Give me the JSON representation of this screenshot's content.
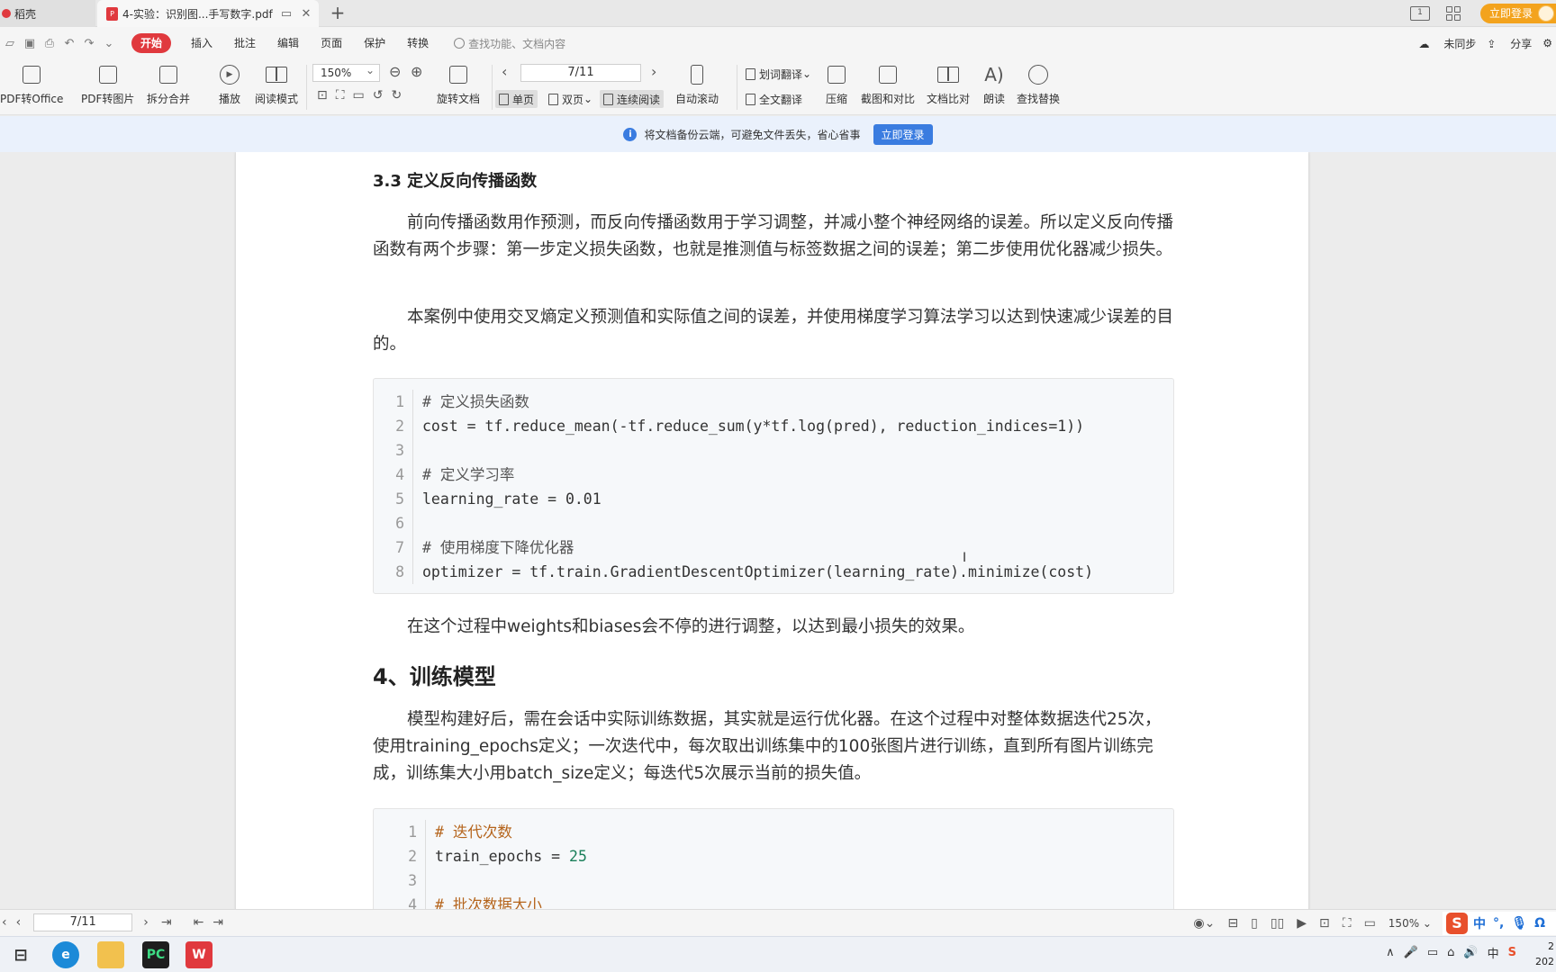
{
  "tabs": {
    "home_label": "稻壳",
    "doc_label": "4-实验：识别图...手写数字.pdf",
    "login_label": "立即登录"
  },
  "menubar": {
    "items": [
      "开始",
      "插入",
      "批注",
      "编辑",
      "页面",
      "保护",
      "转换"
    ],
    "search_placeholder": "查找功能、文档内容",
    "sync_label": "未同步",
    "share_label": "分享"
  },
  "ribbon": {
    "pdf_to_office": "PDF转Office",
    "pdf_to_image": "PDF转图片",
    "split_merge": "拆分合并",
    "play": "播放",
    "read_mode": "阅读模式",
    "zoom": "150%",
    "rotate_doc": "旋转文档",
    "page_indicator": "7/11",
    "single_page": "单页",
    "double_page": "双页",
    "continuous_read": "连续阅读",
    "auto_scroll": "自动滚动",
    "word_translate": "划词翻译",
    "full_translate": "全文翻译",
    "compress": "压缩",
    "screenshot_compare": "截图和对比",
    "doc_compare": "文档比对",
    "read_aloud": "朗读",
    "find_replace": "查找替换"
  },
  "notice": {
    "text": "将文档备份云端，可避免文件丢失，省心省事",
    "button": "立即登录"
  },
  "document": {
    "section_3_3": "3.3 定义反向传播函数",
    "para1": "前向传播函数用作预测，而反向传播函数用于学习调整，并减小整个神经网络的误差。所以定义反向传播函数有两个步骤：第一步定义损失函数，也就是推测值与标签数据之间的误差；第二步使用优化器减少损失。",
    "para2": "本案例中使用交叉熵定义预测值和实际值之间的误差，并使用梯度学习算法学习以达到快速减少误差的目的。",
    "code1": [
      {
        "n": "1",
        "text": "# 定义损失函数"
      },
      {
        "n": "2",
        "text": "cost = tf.reduce_mean(-tf.reduce_sum(y*tf.log(pred), reduction_indices=1))"
      },
      {
        "n": "3",
        "text": ""
      },
      {
        "n": "4",
        "text": "# 定义学习率"
      },
      {
        "n": "5",
        "text": "learning_rate = 0.01"
      },
      {
        "n": "6",
        "text": ""
      },
      {
        "n": "7",
        "text": "# 使用梯度下降优化器"
      },
      {
        "n": "8",
        "text": "optimizer = tf.train.GradientDescentOptimizer(learning_rate).minimize(cost)"
      }
    ],
    "para3": "在这个过程中weights和biases会不停的进行调整，以达到最小损失的效果。",
    "section_4": "4、训练模型",
    "para4": "模型构建好后，需在会话中实际训练数据，其实就是运行优化器。在这个过程中对整体数据迭代25次，使用training_epochs定义；一次迭代中，每次取出训练集中的100张图片进行训练，直到所有图片训练完成，训练集大小用batch_size定义；每迭代5次展示当前的损失值。",
    "code2": [
      {
        "n": "1",
        "text": "# 迭代次数"
      },
      {
        "n": "2",
        "text_a": "train_epochs = ",
        "text_b": "25"
      },
      {
        "n": "3",
        "text": ""
      },
      {
        "n": "4",
        "text": "# 批次数据大小"
      }
    ]
  },
  "statusbar": {
    "page_indicator": "7/11",
    "zoom": "150%",
    "ime_chinese": "中"
  },
  "taskbar": {
    "clock_line1": "2",
    "clock_line2": "202"
  },
  "colors": {
    "accent_red": "#e0393e",
    "login_orange": "#f3a31d",
    "notice_blue": "#3a7ce0"
  }
}
